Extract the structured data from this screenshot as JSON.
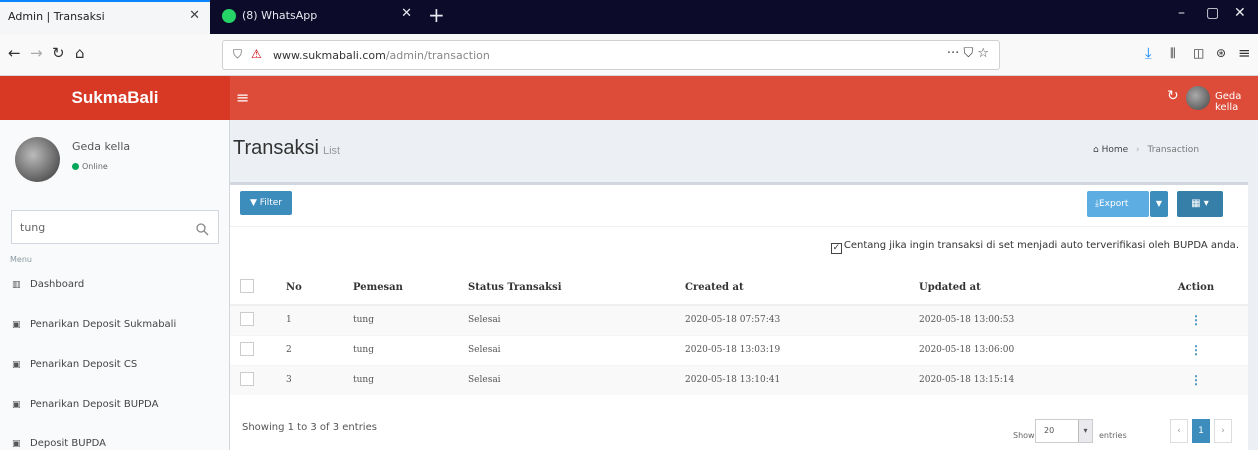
{
  "browser": {
    "tabs": [
      {
        "label": "Admin | Transaksi"
      },
      {
        "label": "(8) WhatsApp"
      }
    ],
    "url_host": "www.sukmabali.com",
    "url_path": "/admin/transaction"
  },
  "header": {
    "brand": "SukmaBali",
    "user": "Geda kella"
  },
  "sidebar": {
    "user_name": "Geda kella",
    "status": "Online",
    "search_value": "tung",
    "menu_heading": "Menu",
    "items": [
      {
        "label": "Dashboard",
        "icon": "chart-icon"
      },
      {
        "label": "Penarikan Deposit Sukmabali",
        "icon": "list-icon"
      },
      {
        "label": "Penarikan Deposit CS",
        "icon": "list-icon"
      },
      {
        "label": "Penarikan Deposit BUPDA",
        "icon": "list-icon"
      },
      {
        "label": "Deposit BUPDA",
        "icon": "list-icon"
      }
    ]
  },
  "page": {
    "title": "Transaksi",
    "subtitle": "List",
    "breadcrumb_home": "Home",
    "breadcrumb_current": "Transaction"
  },
  "toolbar": {
    "filter_label": "Filter",
    "export_label": "Export"
  },
  "auto_verify_label": "Centang jika ingin transaksi di set menjadi auto terverifikasi oleh BUPDA anda.",
  "auto_verify_checked": true,
  "table": {
    "headers": [
      "No",
      "Pemesan",
      "Status Transaksi",
      "Created at",
      "Updated at",
      "Action"
    ],
    "rows": [
      {
        "no": "1",
        "pemesan": "tung",
        "status": "Selesai",
        "created": "2020-05-18 07:57:43",
        "updated": "2020-05-18 13:00:53"
      },
      {
        "no": "2",
        "pemesan": "tung",
        "status": "Selesai",
        "created": "2020-05-18 13:03:19",
        "updated": "2020-05-18 13:06:00"
      },
      {
        "no": "3",
        "pemesan": "tung",
        "status": "Selesai",
        "created": "2020-05-18 13:10:41",
        "updated": "2020-05-18 13:15:14"
      }
    ]
  },
  "footer": {
    "showing": "Showing 1 to 3 of 3 entries",
    "show_label": "Show",
    "page_length": "20",
    "entries_label": "entries",
    "pages": [
      "‹",
      "1",
      "›"
    ]
  },
  "colors": {
    "header_red": "#dd4b39",
    "primary_blue": "#3c8dbc",
    "online_green": "#00a65a"
  }
}
